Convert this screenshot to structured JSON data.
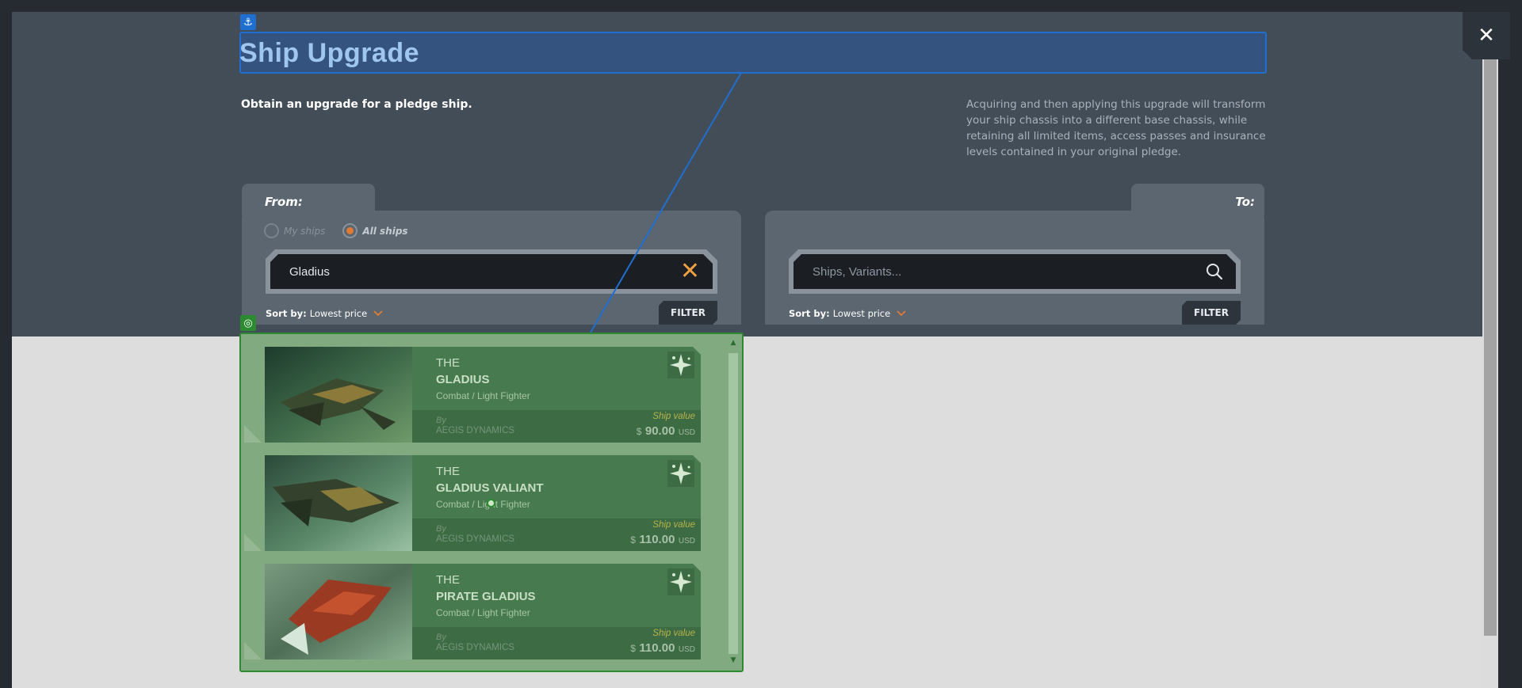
{
  "page": {
    "title": "Ship Upgrade",
    "subtitle": "Obtain an upgrade for a pledge ship.",
    "description": "Acquiring and then applying this upgrade will transform your ship chassis into a different base chassis, while retaining all limited items, access passes and insurance levels contained in your original pledge.",
    "close_label": "✕",
    "anchor_icon": "⚓",
    "target_icon": "◎"
  },
  "from_panel": {
    "label": "From:",
    "radio_my_ships": "My ships",
    "radio_all_ships": "All ships",
    "selected_radio": "All ships",
    "search_value": "Gladius",
    "clear_icon": "✕",
    "sort_prefix": "Sort by:",
    "sort_value": "Lowest price",
    "filter_label": "FILTER"
  },
  "to_panel": {
    "label": "To:",
    "search_placeholder": "Ships, Variants...",
    "sort_prefix": "Sort by:",
    "sort_value": "Lowest price",
    "filter_label": "FILTER"
  },
  "ships": [
    {
      "the": "THE",
      "name": "GLADIUS",
      "role": "Combat / Light Fighter",
      "by": "By",
      "manufacturer": "AEGIS DYNAMICS",
      "value_label": "Ship value",
      "currency": "$",
      "price": "90.00",
      "unit": "USD"
    },
    {
      "the": "THE",
      "name": "GLADIUS VALIANT",
      "role": "Combat / Light Fighter",
      "by": "By",
      "manufacturer": "AEGIS DYNAMICS",
      "value_label": "Ship value",
      "currency": "$",
      "price": "110.00",
      "unit": "USD"
    },
    {
      "the": "THE",
      "name": "PIRATE GLADIUS",
      "role": "Combat / Light Fighter",
      "by": "By",
      "manufacturer": "AEGIS DYNAMICS",
      "value_label": "Ship value",
      "currency": "$",
      "price": "110.00",
      "unit": "USD"
    }
  ],
  "colors": {
    "accent_orange": "#e07b33",
    "highlight_blue": "#1f6fd1",
    "highlight_green": "#2d8a31"
  }
}
